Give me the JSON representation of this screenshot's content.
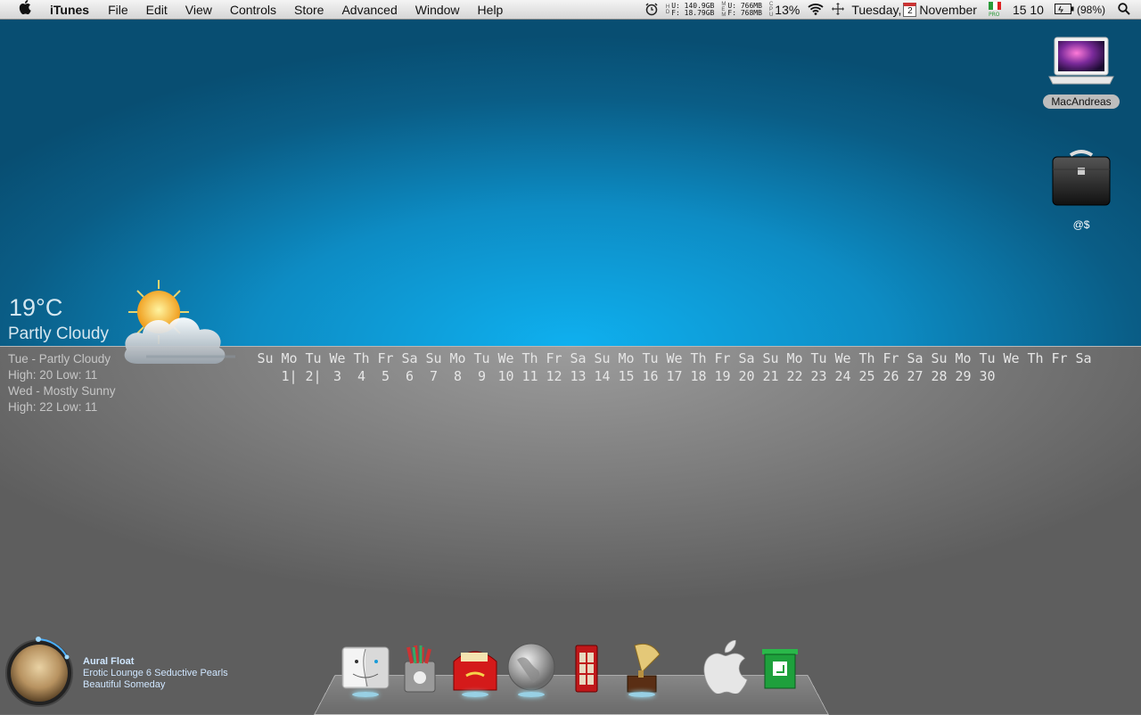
{
  "menubar": {
    "app_name": "iTunes",
    "menus": [
      "File",
      "Edit",
      "View",
      "Controls",
      "Store",
      "Advanced",
      "Window",
      "Help"
    ],
    "status": {
      "disk_used": "140.9GB",
      "disk_free": "18.79GB",
      "mem_used": "766MB",
      "mem_free": "768MB",
      "cpu": "13%",
      "day": "Tuesday,",
      "cal_icon_day": "2",
      "month": "November",
      "time": "15 10",
      "battery": "(98%)",
      "disk_u_label": "U:",
      "disk_f_label": "F:",
      "mem_u_label": "U:",
      "mem_f_label": "F:"
    }
  },
  "weather": {
    "temperature": "19°C",
    "condition": "Partly Cloudy",
    "forecast": [
      {
        "day": "Tue - Partly Cloudy",
        "range": "High: 20 Low: 11"
      },
      {
        "day": "Wed - Mostly Sunny",
        "range": "High: 22 Low: 11"
      }
    ]
  },
  "calendar": {
    "weekdays": [
      "Su",
      "Mo",
      "Tu",
      "We",
      "Th",
      "Fr",
      "Sa",
      "Su",
      "Mo",
      "Tu",
      "We",
      "Th",
      "Fr",
      "Sa",
      "Su",
      "Mo",
      "Tu",
      "We",
      "Th",
      "Fr",
      "Sa",
      "Su",
      "Mo",
      "Tu",
      "We",
      "Th",
      "Fr",
      "Sa",
      "Su",
      "Mo",
      "Tu",
      "We",
      "Th",
      "Fr",
      "Sa"
    ],
    "dates": [
      "",
      "1|",
      "2|",
      "3",
      "4",
      "5",
      "6",
      "7",
      "8",
      "9",
      "10",
      "11",
      "12",
      "13",
      "14",
      "15",
      "16",
      "17",
      "18",
      "19",
      "20",
      "21",
      "22",
      "23",
      "24",
      "25",
      "26",
      "27",
      "28",
      "29",
      "30"
    ]
  },
  "desktop_icons": [
    {
      "label": "MacAndreas",
      "icon": "laptop-icon"
    },
    {
      "label": "@$",
      "icon": "briefcase-icon"
    }
  ],
  "now_playing": {
    "artist": "Aural Float",
    "album": "Erotic Lounge 6 Seductive Pearls",
    "track": "Beautiful Someday"
  },
  "dock": [
    {
      "name": "finder",
      "icon": "finder-icon"
    },
    {
      "name": "applications",
      "icon": "pencil-cup-icon"
    },
    {
      "name": "mail",
      "icon": "mailbox-icon"
    },
    {
      "name": "safari",
      "icon": "globe-icon"
    },
    {
      "name": "contacts",
      "icon": "phone-booth-icon"
    },
    {
      "name": "itunes",
      "icon": "gramophone-icon"
    },
    {
      "name": "apple",
      "icon": "apple-logo-icon"
    },
    {
      "name": "trash",
      "icon": "trash-icon"
    }
  ],
  "colors": {
    "desktop_blue": "#0fb0ef",
    "text_light": "#e6e6e6"
  }
}
